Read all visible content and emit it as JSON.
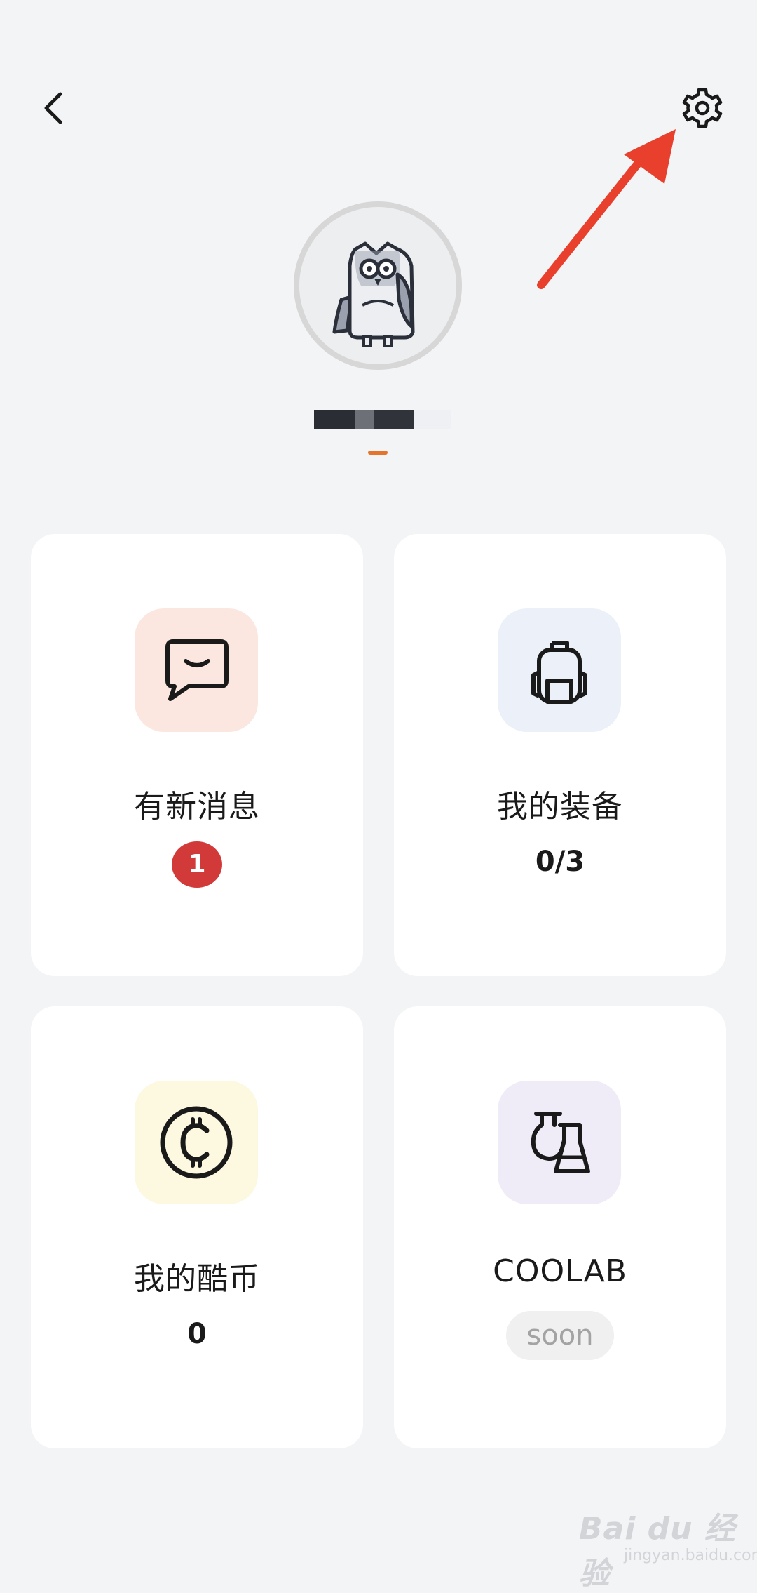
{
  "header": {
    "back_icon": "chevron-left-icon",
    "settings_icon": "gear-icon"
  },
  "profile": {
    "avatar_icon": "owl-avatar-icon",
    "username": "",
    "accent_color": "#e5752c"
  },
  "cards": [
    {
      "id": "messages",
      "icon": "chat-bubble-icon",
      "icon_bg": "#fbe7df",
      "title": "有新消息",
      "badge": "1",
      "badge_color": "#d23a3a"
    },
    {
      "id": "equipment",
      "icon": "backpack-icon",
      "icon_bg": "#ebf0f9",
      "title": "我的装备",
      "value": "0/3"
    },
    {
      "id": "coins",
      "icon": "coin-icon",
      "icon_bg": "#fdf8e0",
      "title": "我的酷币",
      "value": "0"
    },
    {
      "id": "coolab",
      "icon": "flask-icon",
      "icon_bg": "#efecf8",
      "title": "COOLAB",
      "status": "soon"
    }
  ],
  "watermark": {
    "text": "Bai du 经验",
    "sub": "jingyan.baidu.com"
  }
}
